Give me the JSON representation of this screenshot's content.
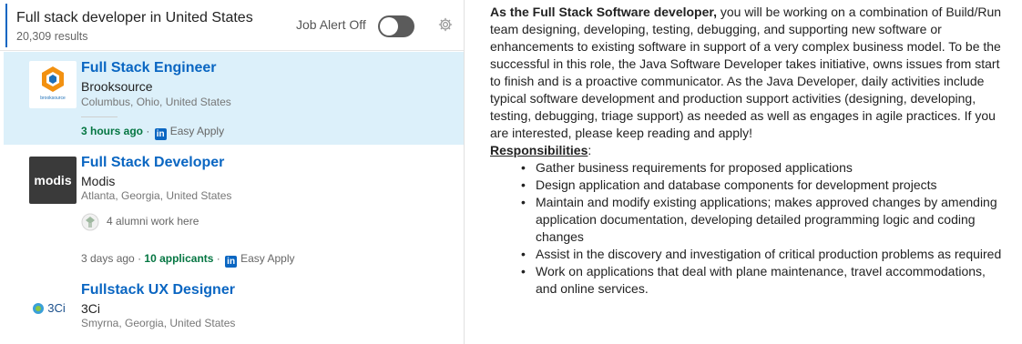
{
  "search": {
    "title": "Full stack developer in United States",
    "result_count": "20,309 results",
    "job_alert_label": "Job Alert Off",
    "job_alert_on": false
  },
  "jobs": [
    {
      "title": "Full Stack Engineer",
      "company": "Brooksource",
      "location": "Columbus, Ohio, United States",
      "posted": "3 hours ago",
      "separator": "·",
      "apply": "Easy Apply",
      "logo_text": "brooksource",
      "selected": true
    },
    {
      "title": "Full Stack Developer",
      "company": "Modis",
      "location": "Atlanta, Georgia, United States",
      "alumni": "4 alumni work here",
      "posted": "3 days ago",
      "separator": "·",
      "applicants": "10 applicants",
      "apply": "Easy Apply",
      "logo_text": "modis"
    },
    {
      "title": "Fullstack UX Designer",
      "company": "3Ci",
      "location": "Smyrna, Georgia, United States",
      "logo_text": "3Ci"
    }
  ],
  "detail": {
    "intro_bold": "As the Full Stack Software developer,",
    "intro_rest": " you will be working on a combination of Build/Run team designing, developing, testing, debugging, and supporting new software or enhancements to existing software in support of a very complex business model. To be the successful in this role, the Java Software Developer takes initiative, owns issues from start to finish and is a proactive communicator. As the Java Developer, daily activities include typical software development and production support activities (designing, developing, testing, debugging, triage support) as needed as well as engages in agile practices. If you are interested, please keep reading and apply!",
    "responsibilities_heading": "Responsibilities",
    "responsibilities_colon": ":",
    "responsibilities": [
      "Gather business requirements for proposed applications",
      "Design application and database components for development projects",
      "Maintain and modify existing applications; makes approved changes by amending application documentation, developing detailed programming logic and coding changes",
      "Assist in the discovery and investigation of critical production problems as required",
      "Work on applications that deal with plane maintenance, travel accommodations, and online services."
    ]
  },
  "colors": {
    "link_blue": "#0a66c2",
    "selected_bg": "#dcf0fa",
    "green": "#057642"
  },
  "icons": [
    "gear-icon",
    "linkedin-icon",
    "alumni-icon"
  ]
}
